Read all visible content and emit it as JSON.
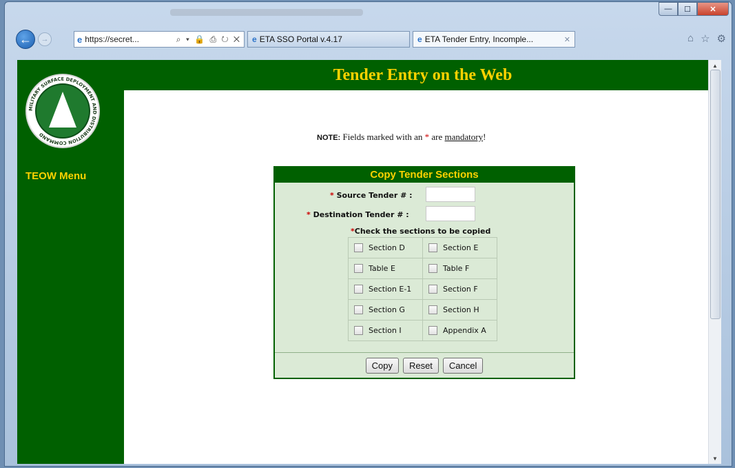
{
  "browser": {
    "address": "https://secret...",
    "address_controls": "⌕ ▾ 🔒 ⎙ ↻ ✕",
    "tabs": [
      {
        "label": "ETA SSO Portal v.4.17"
      },
      {
        "label": "ETA Tender Entry, Incomple...",
        "close": "✕"
      }
    ],
    "window_controls": {
      "minimize": "—",
      "maximize": "☐",
      "close": "✕"
    },
    "right_icons": {
      "home": "⌂",
      "favorites": "☆",
      "tools": "⚙"
    }
  },
  "sidebar": {
    "menu_title": "TEOW Menu",
    "logo_text": "MILITARY SURFACE DEPLOYMENT AND DISTRIBUTION COMMAND"
  },
  "header": {
    "title": "Tender Entry on the Web"
  },
  "note": {
    "prefix": "NOTE:",
    "text_before": " Fields marked with an ",
    "star": "*",
    "text_mid": " are ",
    "emphasis": "mandatory",
    "text_after": "!"
  },
  "form": {
    "title": "Copy Tender Sections",
    "source_label": "Source Tender # :",
    "destination_label": "Destination Tender # :",
    "required_star": "*",
    "check_header": "Check the sections to be copied",
    "sections": [
      [
        "Section D",
        "Section E"
      ],
      [
        "Table E",
        "Table F"
      ],
      [
        "Section E-1",
        "Section F"
      ],
      [
        "Section G",
        "Section H"
      ],
      [
        "Section I",
        "Appendix A"
      ]
    ],
    "buttons": {
      "copy": "Copy",
      "reset": "Reset",
      "cancel": "Cancel"
    }
  },
  "colors": {
    "brand_green": "#006000",
    "accent_yellow": "#ffd200",
    "required_red": "#cc0000",
    "panel_bg": "#dbead6"
  }
}
